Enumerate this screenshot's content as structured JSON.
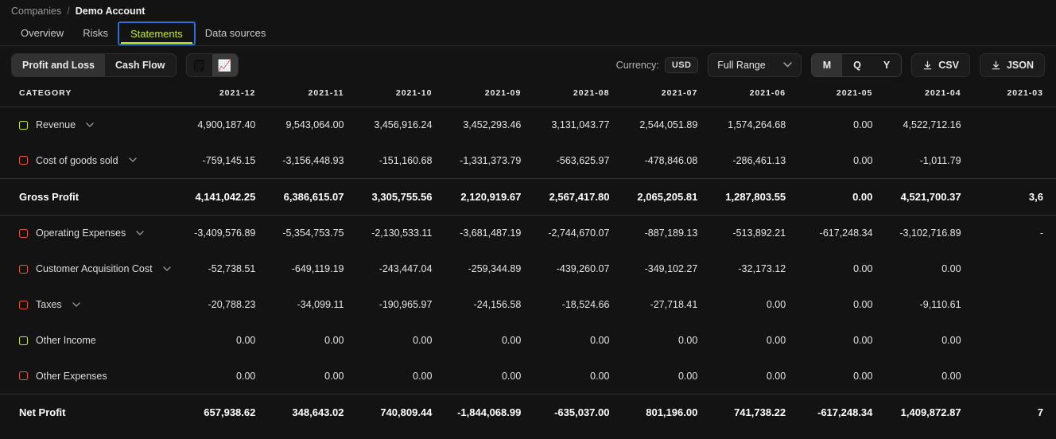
{
  "breadcrumb": {
    "parent": "Companies",
    "separator": "/",
    "current": "Demo Account"
  },
  "tabs": [
    {
      "label": "Overview",
      "active": false
    },
    {
      "label": "Risks",
      "active": false
    },
    {
      "label": "Statements",
      "active": true
    },
    {
      "label": "Data sources",
      "active": false
    }
  ],
  "toolbar": {
    "statement_toggle": [
      {
        "label": "Profit and Loss",
        "selected": true
      },
      {
        "label": "Cash Flow",
        "selected": false
      }
    ],
    "view_icons": [
      {
        "name": "table-view-icon",
        "glyph": "🗒",
        "selected": false
      },
      {
        "name": "chart-view-icon",
        "glyph": "📈",
        "selected": true
      }
    ],
    "currency_label": "Currency:",
    "currency_value": "USD",
    "range_value": "Full Range",
    "period_toggle": [
      {
        "label": "M",
        "selected": true
      },
      {
        "label": "Q",
        "selected": false
      },
      {
        "label": "Y",
        "selected": false
      }
    ],
    "export_csv": "CSV",
    "export_json": "JSON"
  },
  "table": {
    "category_header": "Category",
    "columns": [
      "2021-12",
      "2021-11",
      "2021-10",
      "2021-09",
      "2021-08",
      "2021-07",
      "2021-06",
      "2021-05",
      "2021-04",
      "2021-03"
    ],
    "rows": [
      {
        "label": "Revenue",
        "swatch": "green",
        "expandable": true,
        "type": "item",
        "values": [
          "4,900,187.40",
          "9,543,064.00",
          "3,456,916.24",
          "3,452,293.46",
          "3,131,043.77",
          "2,544,051.89",
          "1,574,264.68",
          "0.00",
          "4,522,712.16",
          ""
        ]
      },
      {
        "label": "Cost of goods sold",
        "swatch": "red",
        "expandable": true,
        "type": "item",
        "values": [
          "-759,145.15",
          "-3,156,448.93",
          "-151,160.68",
          "-1,331,373.79",
          "-563,625.97",
          "-478,846.08",
          "-286,461.13",
          "0.00",
          "-1,011.79",
          ""
        ]
      },
      {
        "label": "Gross Profit",
        "swatch": null,
        "expandable": false,
        "type": "summary",
        "values": [
          "4,141,042.25",
          "6,386,615.07",
          "3,305,755.56",
          "2,120,919.67",
          "2,567,417.80",
          "2,065,205.81",
          "1,287,803.55",
          "0.00",
          "4,521,700.37",
          "3,6"
        ]
      },
      {
        "label": "Operating Expenses",
        "swatch": "red",
        "expandable": true,
        "type": "item",
        "values": [
          "-3,409,576.89",
          "-5,354,753.75",
          "-2,130,533.11",
          "-3,681,487.19",
          "-2,744,670.07",
          "-887,189.13",
          "-513,892.21",
          "-617,248.34",
          "-3,102,716.89",
          "-"
        ]
      },
      {
        "label": "Customer Acquisition Cost",
        "swatch": "red",
        "expandable": true,
        "type": "item",
        "values": [
          "-52,738.51",
          "-649,119.19",
          "-243,447.04",
          "-259,344.89",
          "-439,260.07",
          "-349,102.27",
          "-32,173.12",
          "0.00",
          "0.00",
          ""
        ]
      },
      {
        "label": "Taxes",
        "swatch": "red",
        "expandable": true,
        "type": "item",
        "values": [
          "-20,788.23",
          "-34,099.11",
          "-190,965.97",
          "-24,156.58",
          "-18,524.66",
          "-27,718.41",
          "0.00",
          "0.00",
          "-9,110.61",
          ""
        ]
      },
      {
        "label": "Other Income",
        "swatch": "green",
        "expandable": false,
        "type": "item",
        "values": [
          "0.00",
          "0.00",
          "0.00",
          "0.00",
          "0.00",
          "0.00",
          "0.00",
          "0.00",
          "0.00",
          ""
        ]
      },
      {
        "label": "Other Expenses",
        "swatch": "red",
        "expandable": false,
        "type": "item",
        "values": [
          "0.00",
          "0.00",
          "0.00",
          "0.00",
          "0.00",
          "0.00",
          "0.00",
          "0.00",
          "0.00",
          ""
        ]
      },
      {
        "label": "Net Profit",
        "swatch": null,
        "expandable": false,
        "type": "summary",
        "values": [
          "657,938.62",
          "348,643.02",
          "740,809.44",
          "-1,844,068.99",
          "-635,037.00",
          "801,196.00",
          "741,738.22",
          "-617,248.34",
          "1,409,872.87",
          "7"
        ]
      }
    ]
  },
  "colors": {
    "accent_green": "#c3e82b",
    "accent_red": "#e5563f",
    "focus_blue": "#2f6fd0",
    "background": "#131313"
  }
}
